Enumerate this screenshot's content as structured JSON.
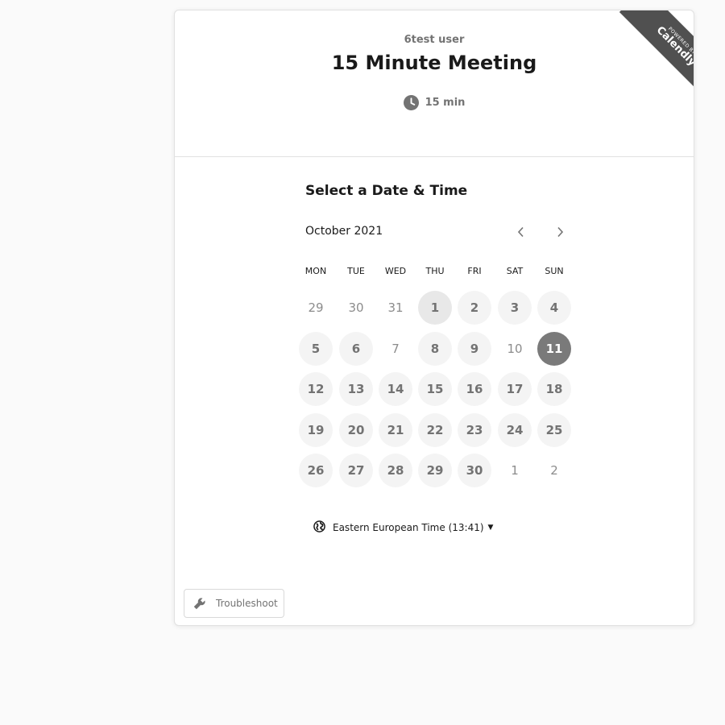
{
  "header": {
    "host_name": "6test user",
    "event_title": "15 Minute Meeting",
    "duration": "15 min",
    "ribbon_small": "POWERED BY",
    "ribbon_brand": "Calendly"
  },
  "calendar": {
    "heading": "Select a Date & Time",
    "month_label": "October 2021",
    "weekdays": [
      "MON",
      "TUE",
      "WED",
      "THU",
      "FRI",
      "SAT",
      "SUN"
    ],
    "weeks": [
      [
        {
          "d": "29",
          "s": "unavail"
        },
        {
          "d": "30",
          "s": "unavail"
        },
        {
          "d": "31",
          "s": "unavail"
        },
        {
          "d": "1",
          "s": "today"
        },
        {
          "d": "2",
          "s": "avail"
        },
        {
          "d": "3",
          "s": "avail"
        },
        {
          "d": "4",
          "s": "avail"
        }
      ],
      [
        {
          "d": "5",
          "s": "avail"
        },
        {
          "d": "6",
          "s": "avail"
        },
        {
          "d": "7",
          "s": "unavail"
        },
        {
          "d": "8",
          "s": "avail"
        },
        {
          "d": "9",
          "s": "avail"
        },
        {
          "d": "10",
          "s": "unavail"
        },
        {
          "d": "11",
          "s": "selected"
        }
      ],
      [
        {
          "d": "12",
          "s": "avail"
        },
        {
          "d": "13",
          "s": "avail"
        },
        {
          "d": "14",
          "s": "avail"
        },
        {
          "d": "15",
          "s": "avail"
        },
        {
          "d": "16",
          "s": "avail"
        },
        {
          "d": "17",
          "s": "avail"
        },
        {
          "d": "18",
          "s": "avail"
        }
      ],
      [
        {
          "d": "19",
          "s": "avail"
        },
        {
          "d": "20",
          "s": "avail"
        },
        {
          "d": "21",
          "s": "avail"
        },
        {
          "d": "22",
          "s": "avail"
        },
        {
          "d": "23",
          "s": "avail"
        },
        {
          "d": "24",
          "s": "avail"
        },
        {
          "d": "25",
          "s": "avail"
        }
      ],
      [
        {
          "d": "26",
          "s": "avail"
        },
        {
          "d": "27",
          "s": "avail"
        },
        {
          "d": "28",
          "s": "avail"
        },
        {
          "d": "29",
          "s": "avail"
        },
        {
          "d": "30",
          "s": "avail"
        },
        {
          "d": "1",
          "s": "unavail"
        },
        {
          "d": "2",
          "s": "unavail"
        }
      ]
    ]
  },
  "timezone": {
    "label": "Eastern European Time (13:41)",
    "icon": "globe-icon"
  },
  "troubleshoot": {
    "label": "Troubleshoot",
    "icon": "wrench-icon"
  },
  "colors": {
    "selected_day": "#7a7a7a",
    "available_day": "#f4f4f4",
    "ribbon": "#505050"
  }
}
